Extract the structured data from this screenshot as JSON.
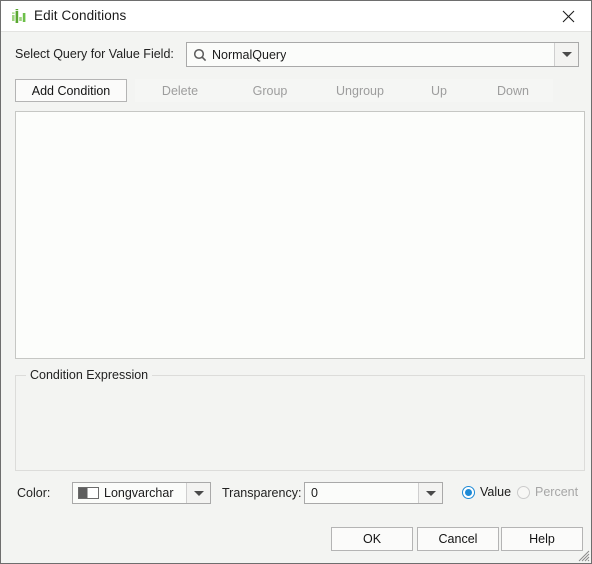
{
  "window": {
    "title": "Edit Conditions",
    "app_icon": "bar-chart-icon",
    "close_icon": "close-icon",
    "resize_grip": "resize-grip-icon"
  },
  "query_row": {
    "label": "Select Query for Value Field:",
    "search_icon": "search-icon",
    "value": "NormalQuery",
    "dropdown_icon": "chevron-down-icon"
  },
  "toolbar": {
    "buttons": [
      {
        "label": "Add Condition",
        "enabled": true
      },
      {
        "label": "Delete",
        "enabled": false
      },
      {
        "label": "Group",
        "enabled": false
      },
      {
        "label": "Ungroup",
        "enabled": false
      },
      {
        "label": "Up",
        "enabled": false
      },
      {
        "label": "Down",
        "enabled": false
      }
    ]
  },
  "conditions_list": {
    "items": []
  },
  "expression_group": {
    "legend": "Condition Expression",
    "text": ""
  },
  "bottom_controls": {
    "color_label": "Color:",
    "color_value": "Longvarchar",
    "color_swatch_icon": "color-swatch-icon",
    "transparency_label": "Transparency:",
    "transparency_value": "0",
    "radio_value_label": "Value",
    "radio_percent_label": "Percent",
    "radio_selected": "Value"
  },
  "dialog_buttons": {
    "ok": "OK",
    "cancel": "Cancel",
    "help": "Help"
  },
  "colors": {
    "accent": "#1e8ad6",
    "icon_green": "#6cbf49",
    "window_bg": "#f3f4f2",
    "field_bg": "#fbfcfa"
  }
}
